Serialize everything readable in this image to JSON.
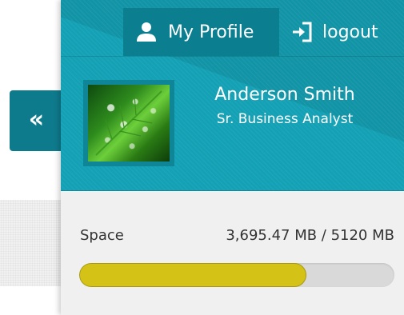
{
  "sidebar_toggle": {
    "label": "«",
    "icon": "chevron-double-left-icon"
  },
  "topbar": {
    "profile_label": "My Profile",
    "profile_icon": "user-icon",
    "logout_label": "logout",
    "logout_icon": "sign-in-icon"
  },
  "user": {
    "name": "Anderson Smith",
    "role": "Sr. Business Analyst",
    "avatar_icon": "leaf-with-water-drops-image"
  },
  "storage": {
    "label": "Space",
    "usage_text": "3,695.47 MB / 5120 MB",
    "used_mb": 3695.47,
    "total_mb": 5120,
    "used_fraction": 0.7218
  },
  "colors": {
    "panel_accent": "#14a1b5",
    "active_link": "#0b7e90",
    "progress_fill": "#d4c217",
    "progress_track": "#d9d9d9"
  }
}
